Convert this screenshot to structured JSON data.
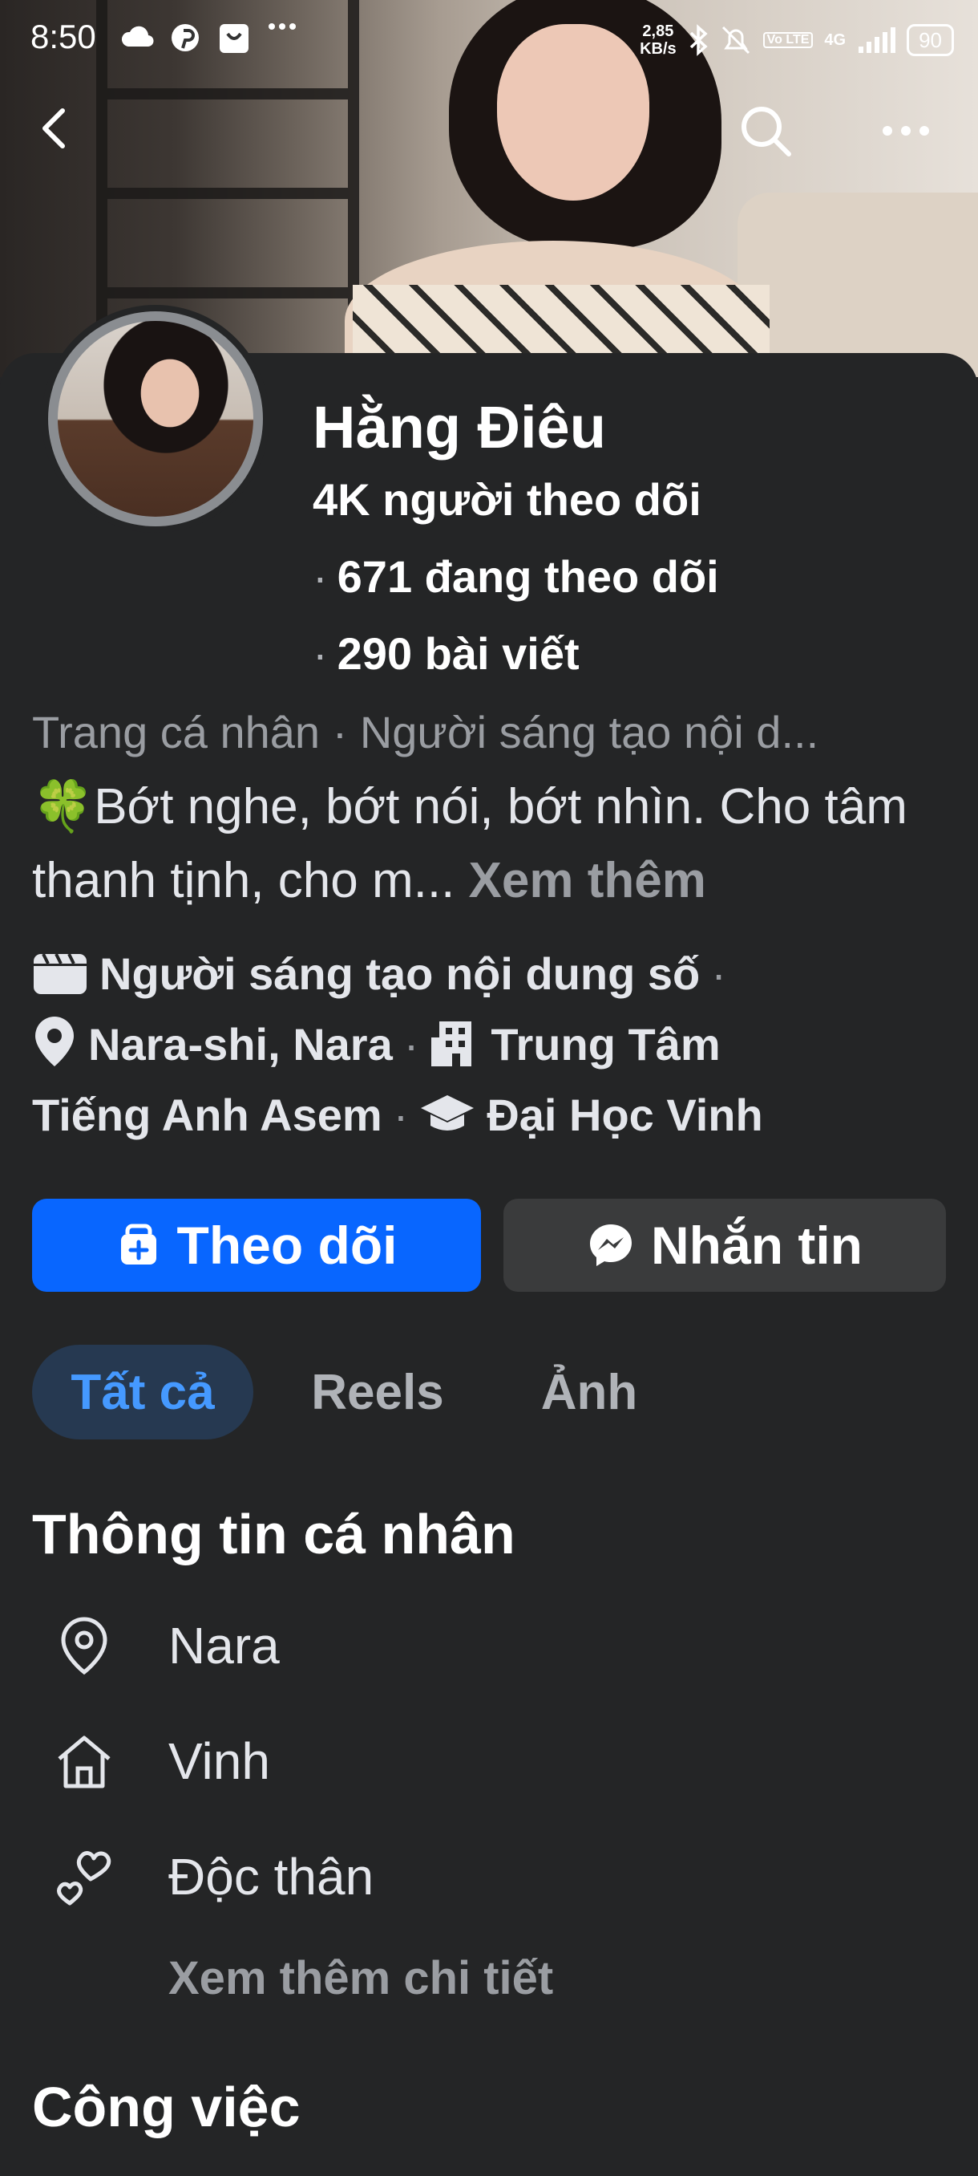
{
  "status_bar": {
    "time": "8:50",
    "net_speed_value": "2,85",
    "net_speed_unit": "KB/s",
    "volte": "Vo LTE",
    "network": "4G",
    "battery": "90",
    "icons": [
      "cloud-icon",
      "pinterest-icon",
      "shopping-bag-icon",
      "more-dots-icon",
      "bluetooth-icon",
      "bell-off-icon",
      "signal-icon"
    ]
  },
  "nav": {
    "back_icon": "chevron-left-icon",
    "search_icon": "search-icon",
    "more_icon": "more-horizontal-icon"
  },
  "profile": {
    "name": "Hằng Điêu",
    "followers": "4K người theo dõi",
    "following_dot": "·",
    "following": "671 đang theo dõi",
    "posts_dot": "·",
    "posts": "290 bài viết",
    "category_line": "Trang cá nhân · Người sáng tạo nội d...",
    "bio_emoji": "🍀",
    "bio": "Bớt nghe, bớt nói, bớt nhìn. Cho tâm thanh tịnh, cho m...",
    "bio_more": "Xem thêm"
  },
  "details": {
    "creator": "Người sáng tạo nội dung số",
    "location": "Nara-shi, Nara",
    "work_1": "Trung Tâm",
    "work_2": "Tiếng Anh Asem",
    "education": "Đại Học Vinh",
    "sep": "·"
  },
  "actions": {
    "follow_label": "Theo dõi",
    "message_label": "Nhắn tin"
  },
  "tabs": {
    "all": "Tất cả",
    "reels": "Reels",
    "photos": "Ảnh"
  },
  "about": {
    "title": "Thông tin cá nhân",
    "items": [
      {
        "icon": "location-pin-icon",
        "label": "Nara"
      },
      {
        "icon": "home-icon",
        "label": "Vinh"
      },
      {
        "icon": "hearts-icon",
        "label": "Độc thân"
      }
    ],
    "see_more": "Xem thêm chi tiết"
  },
  "work": {
    "title": "Công việc"
  },
  "colors": {
    "background": "#242526",
    "primary_button": "#0866ff",
    "secondary_button": "#3a3b3c",
    "active_tab_bg": "#263951",
    "active_tab_text": "#4599ff",
    "muted_text": "#9a9da2"
  }
}
